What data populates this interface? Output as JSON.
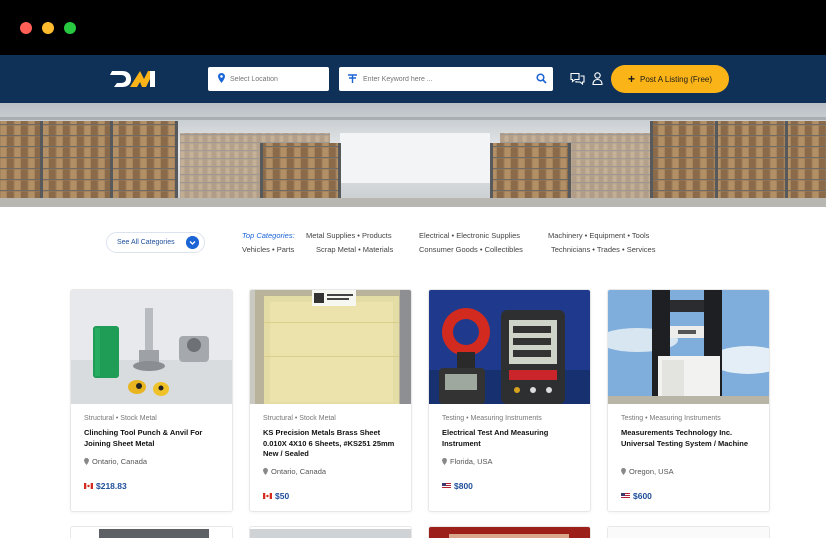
{
  "search": {
    "location_placeholder": "Select Location",
    "keyword_placeholder": "Enter Keyword here ..."
  },
  "header": {
    "post_label": "Post A Listing (Free)"
  },
  "categories": {
    "see_all_label": "See All Categories",
    "top_label": "Top Categories:",
    "links": [
      "Metal Supplies • Products",
      "Electrical • Electronic Supplies",
      "Machinery • Equipment • Tools",
      "Vehicles • Parts",
      "Scrap Metal • Materials",
      "Consumer Goods • Collectibles",
      "Technicians • Trades • Services"
    ]
  },
  "listings": [
    {
      "category": "Structural • Stock Metal",
      "title": "Clinching Tool Punch & Anvil For Joining Sheet Metal",
      "location": "Ontario,  Canada",
      "price": "$218.83",
      "flag": "canada-flag-icon"
    },
    {
      "category": "Structural • Stock Metal",
      "title": "KS Precision Metals Brass Sheet 0.010X 4X10 6 Sheets, #KS251 25mm New / Sealed",
      "location": "Ontario,  Canada",
      "price": "$50",
      "flag": "canada-flag-icon"
    },
    {
      "category": "Testing • Measuring Instruments",
      "title": "Electrical Test And Measuring Instrument",
      "location": "Florida,  USA",
      "price": "$800",
      "flag": "usa-flag-icon"
    },
    {
      "category": "Testing • Measuring Instruments",
      "title": "Measurements Technology Inc. Universal Testing System / Machine",
      "location": "Oregon,  USA",
      "price": "$600",
      "flag": "usa-flag-icon"
    }
  ],
  "colors": {
    "navbar": "#0f3157",
    "accent": "#fbb418",
    "link_blue": "#1a64d6"
  }
}
